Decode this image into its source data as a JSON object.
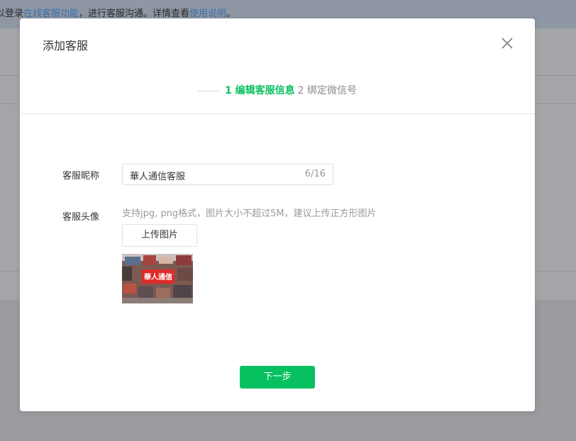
{
  "background": {
    "notice_prefix": "以登录",
    "notice_link1": "在线客服功能",
    "notice_mid": "，进行客服沟通。详情查看",
    "notice_link2": "使用说明",
    "notice_suffix": "。"
  },
  "modal": {
    "title": "添加客服",
    "close_icon": "close-icon"
  },
  "steps": {
    "active_step": "1 编辑客服信息",
    "next_step": "2 绑定微信号"
  },
  "form": {
    "nickname_label": "客服昵称",
    "nickname_value": "華人通信客服",
    "nickname_count": "6/16",
    "avatar_label": "客服头像",
    "avatar_hint": "支持jpg, png格式，图片大小不超过5M，建议上传正方形图片",
    "upload_label": "上传图片",
    "avatar_image_text": "華人通信"
  },
  "footer": {
    "next_label": "下一步"
  },
  "colors": {
    "accent": "#07c160",
    "overlay": "#9a9c9f",
    "link": "#3a6fb0"
  }
}
